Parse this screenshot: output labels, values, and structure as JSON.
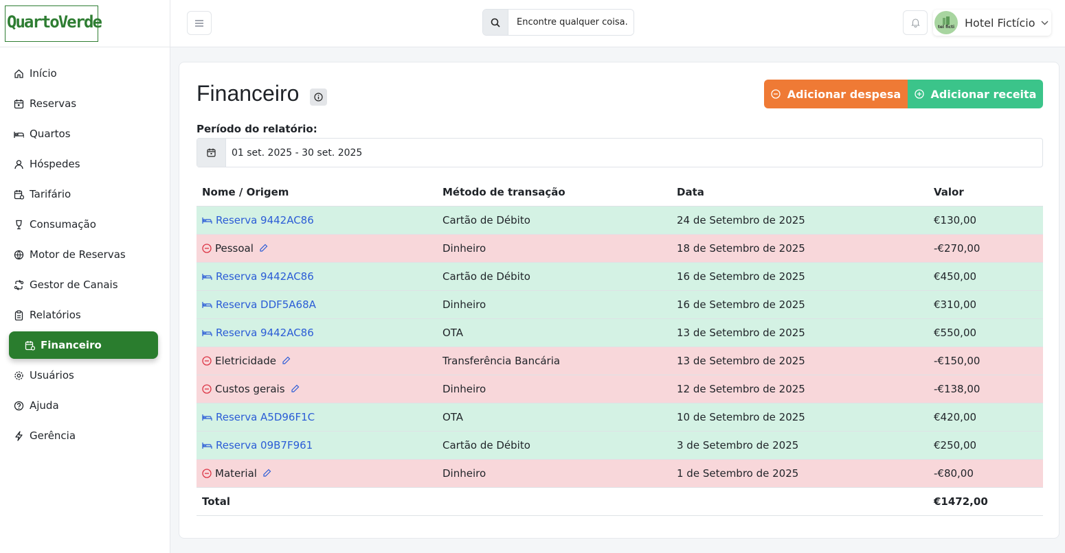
{
  "brand": {
    "logo": "QuartoVerde"
  },
  "nav": [
    {
      "label": "Início",
      "icon": "home-icon"
    },
    {
      "label": "Reservas",
      "icon": "calendar-icon"
    },
    {
      "label": "Quartos",
      "icon": "bed-icon"
    },
    {
      "label": "Hóspedes",
      "icon": "user-icon"
    },
    {
      "label": "Tarifário",
      "icon": "calendar-price-icon"
    },
    {
      "label": "Consumação",
      "icon": "glass-icon"
    },
    {
      "label": "Motor de Reservas",
      "icon": "globe-icon"
    },
    {
      "label": "Gestor de Canais",
      "icon": "sync-icon"
    },
    {
      "label": "Relatórios",
      "icon": "clipboard-icon"
    },
    {
      "label": "Financeiro",
      "icon": "finance-icon",
      "active": true
    },
    {
      "label": "Usuários",
      "icon": "gear-icon"
    },
    {
      "label": "Ajuda",
      "icon": "help-icon"
    },
    {
      "label": "Gerência",
      "icon": "bolt-icon"
    }
  ],
  "topbar": {
    "search_placeholder": "Encontre qualquer coisa.",
    "profile_name": "Hotel Fictício",
    "avatar_text": "tel ficti"
  },
  "page": {
    "title": "Financeiro",
    "add_expense": "Adicionar despesa",
    "add_income": "Adicionar receita",
    "period_label": "Período do relatório:",
    "period_value": "01 set. 2025 - 30 set. 2025"
  },
  "table": {
    "headers": [
      "Nome / Origem",
      "Método de transação",
      "Data",
      "Valor"
    ],
    "rows": [
      {
        "type": "income",
        "name": "Reserva 9442AC86",
        "method": "Cartão de Débito",
        "date": "24 de Setembro de 2025",
        "value": "€130,00"
      },
      {
        "type": "expense",
        "name": "Pessoal",
        "method": "Dinheiro",
        "date": "18 de Setembro de 2025",
        "value": "-€270,00"
      },
      {
        "type": "income",
        "name": "Reserva 9442AC86",
        "method": "Cartão de Débito",
        "date": "16 de Setembro de 2025",
        "value": "€450,00"
      },
      {
        "type": "income",
        "name": "Reserva DDF5A68A",
        "method": "Dinheiro",
        "date": "16 de Setembro de 2025",
        "value": "€310,00"
      },
      {
        "type": "income",
        "name": "Reserva 9442AC86",
        "method": "OTA",
        "date": "13 de Setembro de 2025",
        "value": "€550,00"
      },
      {
        "type": "expense",
        "name": "Eletricidade",
        "method": "Transferência Bancária",
        "date": "13 de Setembro de 2025",
        "value": "-€150,00"
      },
      {
        "type": "expense",
        "name": "Custos gerais",
        "method": "Dinheiro",
        "date": "12 de Setembro de 2025",
        "value": "-€138,00"
      },
      {
        "type": "income",
        "name": "Reserva A5D96F1C",
        "method": "OTA",
        "date": "10 de Setembro de 2025",
        "value": "€420,00"
      },
      {
        "type": "income",
        "name": "Reserva 09B7F961",
        "method": "Cartão de Débito",
        "date": "3 de Setembro de 2025",
        "value": "€250,00"
      },
      {
        "type": "expense",
        "name": "Material",
        "method": "Dinheiro",
        "date": "1 de Setembro de 2025",
        "value": "-€80,00"
      }
    ],
    "total_label": "Total",
    "total_value": "€1472,00"
  },
  "colors": {
    "brand_green": "#2a7d2e",
    "expense_orange": "#ef7a35",
    "income_green": "#3bc48a",
    "income_row": "#d4f2e4",
    "expense_row": "#f8d7da",
    "link_blue": "#2b5cd6"
  }
}
